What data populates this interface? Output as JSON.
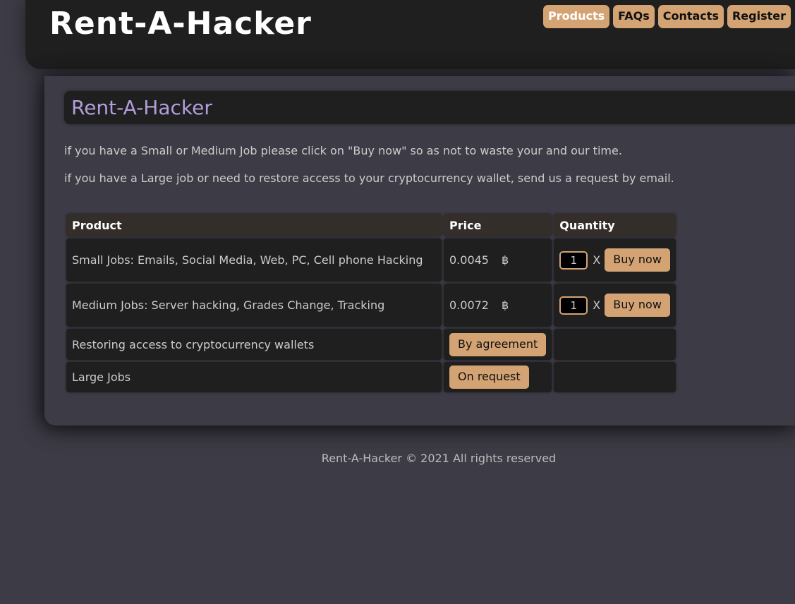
{
  "header": {
    "logo_text": "Rent-A-Hacker",
    "nav": [
      {
        "label": "Products"
      },
      {
        "label": "FAQs"
      },
      {
        "label": "Contacts"
      },
      {
        "label": "Register"
      }
    ]
  },
  "main": {
    "title": "Rent-A-Hacker",
    "intro_1": "if you have a Small or Medium Job please click on \"Buy now\" so as not to waste your and our time.",
    "intro_2": "if you have a Large job or need to restore access to your cryptocurrency wallet, send us a request by email."
  },
  "table": {
    "headers": {
      "product": "Product",
      "price": "Price",
      "quantity": "Quantity"
    },
    "rows": [
      {
        "product": "Small Jobs: Emails, Social Media, Web, PC, Cell phone Hacking",
        "price": "0.0045",
        "currency": "฿",
        "quantity": "1",
        "x": "X",
        "action": "Buy now"
      },
      {
        "product": "Medium Jobs: Server hacking, Grades Change, Tracking",
        "price": "0.0072",
        "currency": "฿",
        "quantity": "1",
        "x": "X",
        "action": "Buy now"
      },
      {
        "product": "Restoring access to cryptocurrency wallets",
        "price_button": "By agreement"
      },
      {
        "product": "Large Jobs",
        "price_button": "On request"
      }
    ]
  },
  "footer": {
    "text": "Rent-A-Hacker © 2021 All rights reserved"
  },
  "colors": {
    "background": "#3d3b45",
    "panel": "#1f1f1f",
    "accent": "#d4a373",
    "title": "#b39ddb"
  }
}
